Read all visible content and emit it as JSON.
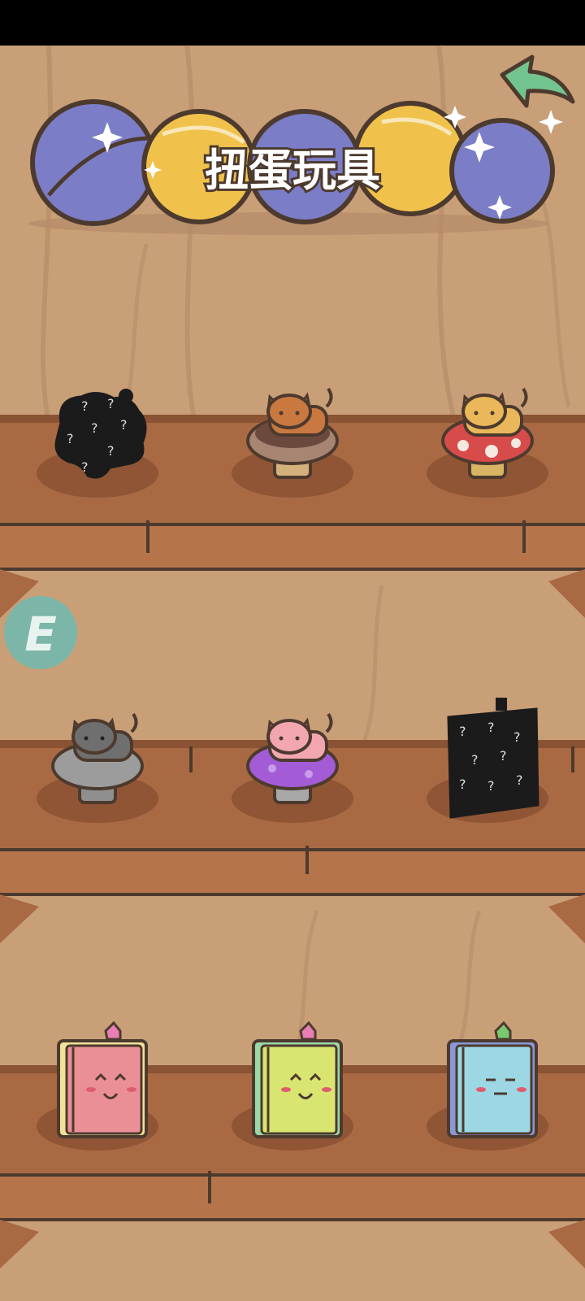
{
  "page": {
    "title": "扭蛋玩具"
  },
  "colors": {
    "wall": "#c99f78",
    "wall_dark": "#b48762",
    "shelf": "#a96a43",
    "shelf_dark": "#8a5333",
    "outline": "#4d3a2e",
    "capsule_blue": "#7b7dc7",
    "capsule_yellow": "#f0c24c",
    "back_arrow": "#72c48e",
    "e_badge": "#6fbab0"
  },
  "shelves": [
    {
      "items": [
        {
          "name": "locked",
          "icon": "locked-cat-mushroom-silhouette",
          "locked": true
        },
        {
          "name": "cat-on-chocolate-donut",
          "icon": "orange-cat-chocolate-mushroom",
          "locked": false
        },
        {
          "name": "cat-on-red-mushroom",
          "icon": "ginger-cat-red-mushroom",
          "locked": false
        }
      ]
    },
    {
      "items": [
        {
          "name": "cat-on-gray-mushroom",
          "icon": "gray-cat-gray-mushroom",
          "locked": false
        },
        {
          "name": "cat-on-purple-mushroom",
          "icon": "pink-cat-purple-mushroom",
          "locked": false
        },
        {
          "name": "locked",
          "icon": "locked-book-silhouette",
          "locked": true
        }
      ]
    },
    {
      "items": [
        {
          "name": "pink-happy-book",
          "icon": "pink-book-happy-face",
          "locked": false
        },
        {
          "name": "green-smile-book",
          "icon": "green-book-smile-face",
          "locked": false
        },
        {
          "name": "blue-calm-book",
          "icon": "blue-book-calm-face",
          "locked": false
        }
      ]
    }
  ],
  "badge": {
    "letter": "E"
  }
}
